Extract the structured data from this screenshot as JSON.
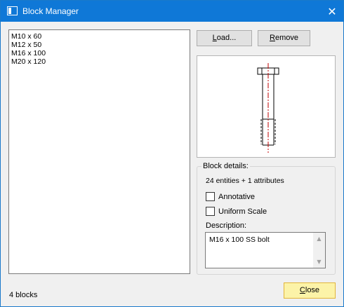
{
  "window": {
    "title": "Block Manager",
    "close_glyph": "✕",
    "title_icon": "window-icon"
  },
  "blocks": [
    {
      "label": "M10 x 60"
    },
    {
      "label": "M12 x 50"
    },
    {
      "label": "M16 x 100"
    },
    {
      "label": "M20 x 120"
    }
  ],
  "buttons": {
    "load_label": "Load...",
    "remove_label": "Remove",
    "close_label": "Close"
  },
  "preview": {
    "icon": "bolt-preview-icon"
  },
  "details": {
    "group_label": "Block details:",
    "summary": "24 entities + 1 attributes",
    "annotative_label": "Annotative",
    "annotative_checked": false,
    "uniform_scale_label": "Uniform Scale",
    "uniform_scale_checked": false,
    "description_label": "Description:",
    "description_value": "M16 x 100 SS bolt",
    "scroll_up_glyph": "▲",
    "scroll_down_glyph": "▼"
  },
  "status": {
    "count_text": "4 blocks"
  },
  "colors": {
    "titlebar": "#0f78d7",
    "close_button_bg": "#fcf3a8",
    "close_button_border": "#e2b53a",
    "centerline": "#c00000"
  }
}
